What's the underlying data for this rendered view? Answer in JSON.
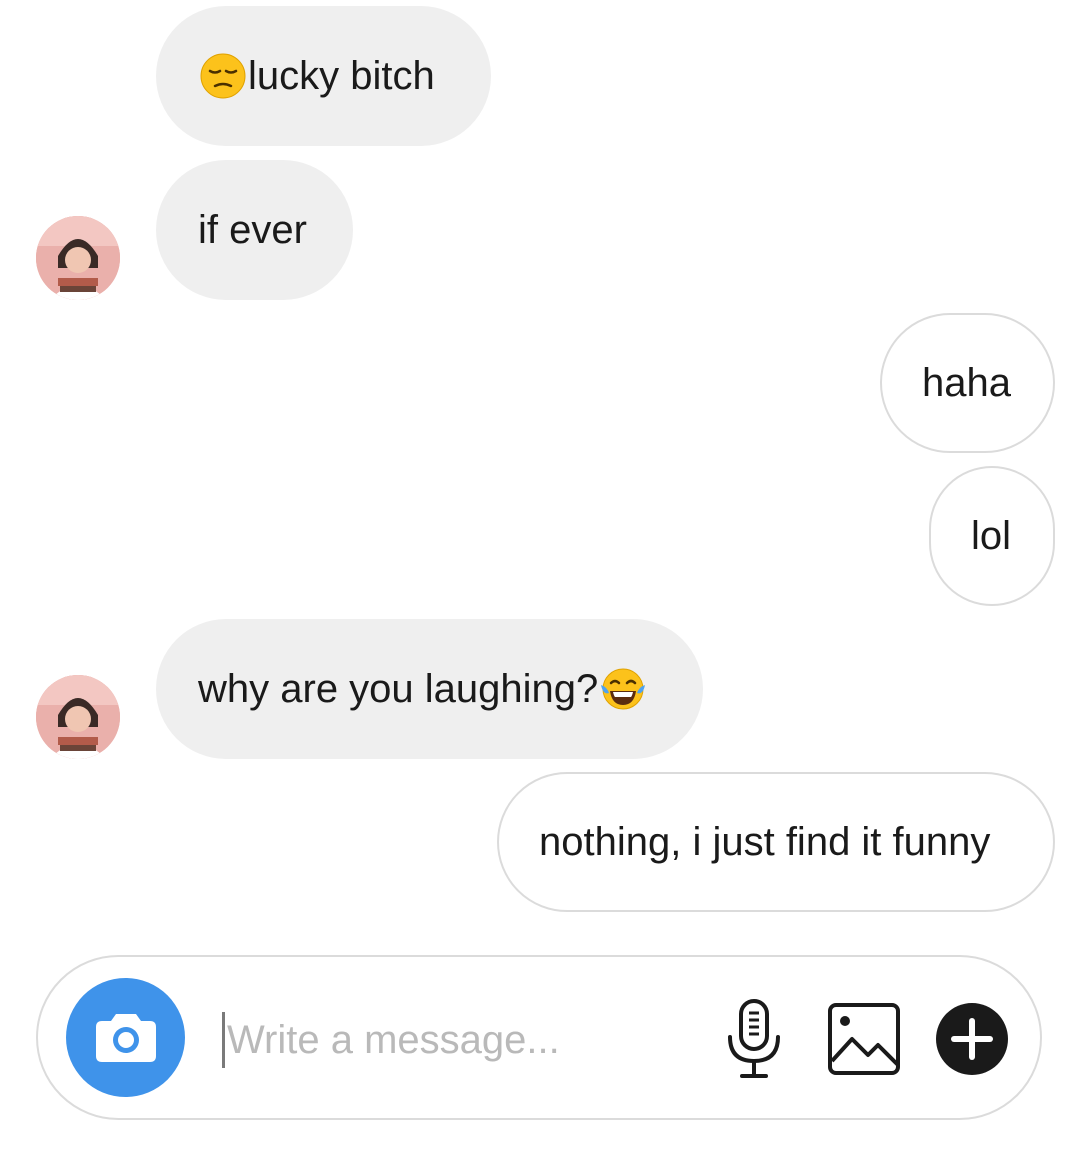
{
  "messages": [
    {
      "side": "in",
      "emoji": "pensive-face-emoji",
      "text": "lucky bitch"
    },
    {
      "side": "in",
      "text": "if ever"
    },
    {
      "side": "out",
      "text": "haha"
    },
    {
      "side": "out",
      "text": "lol"
    },
    {
      "side": "in",
      "text": "why are you laughing?",
      "emoji": "tears-of-joy-emoji"
    },
    {
      "side": "out",
      "text": "nothing, i just find it funny"
    }
  ],
  "composer": {
    "placeholder": "Write a message...",
    "value": "",
    "icons": [
      "camera-icon",
      "microphone-icon",
      "gallery-icon",
      "plus-icon"
    ]
  },
  "colors": {
    "incoming_bubble": "#efefef",
    "outgoing_border": "#dbdbdb",
    "camera_button": "#3f93ea",
    "text": "#1a1a1a",
    "placeholder": "#b9b9b9"
  }
}
